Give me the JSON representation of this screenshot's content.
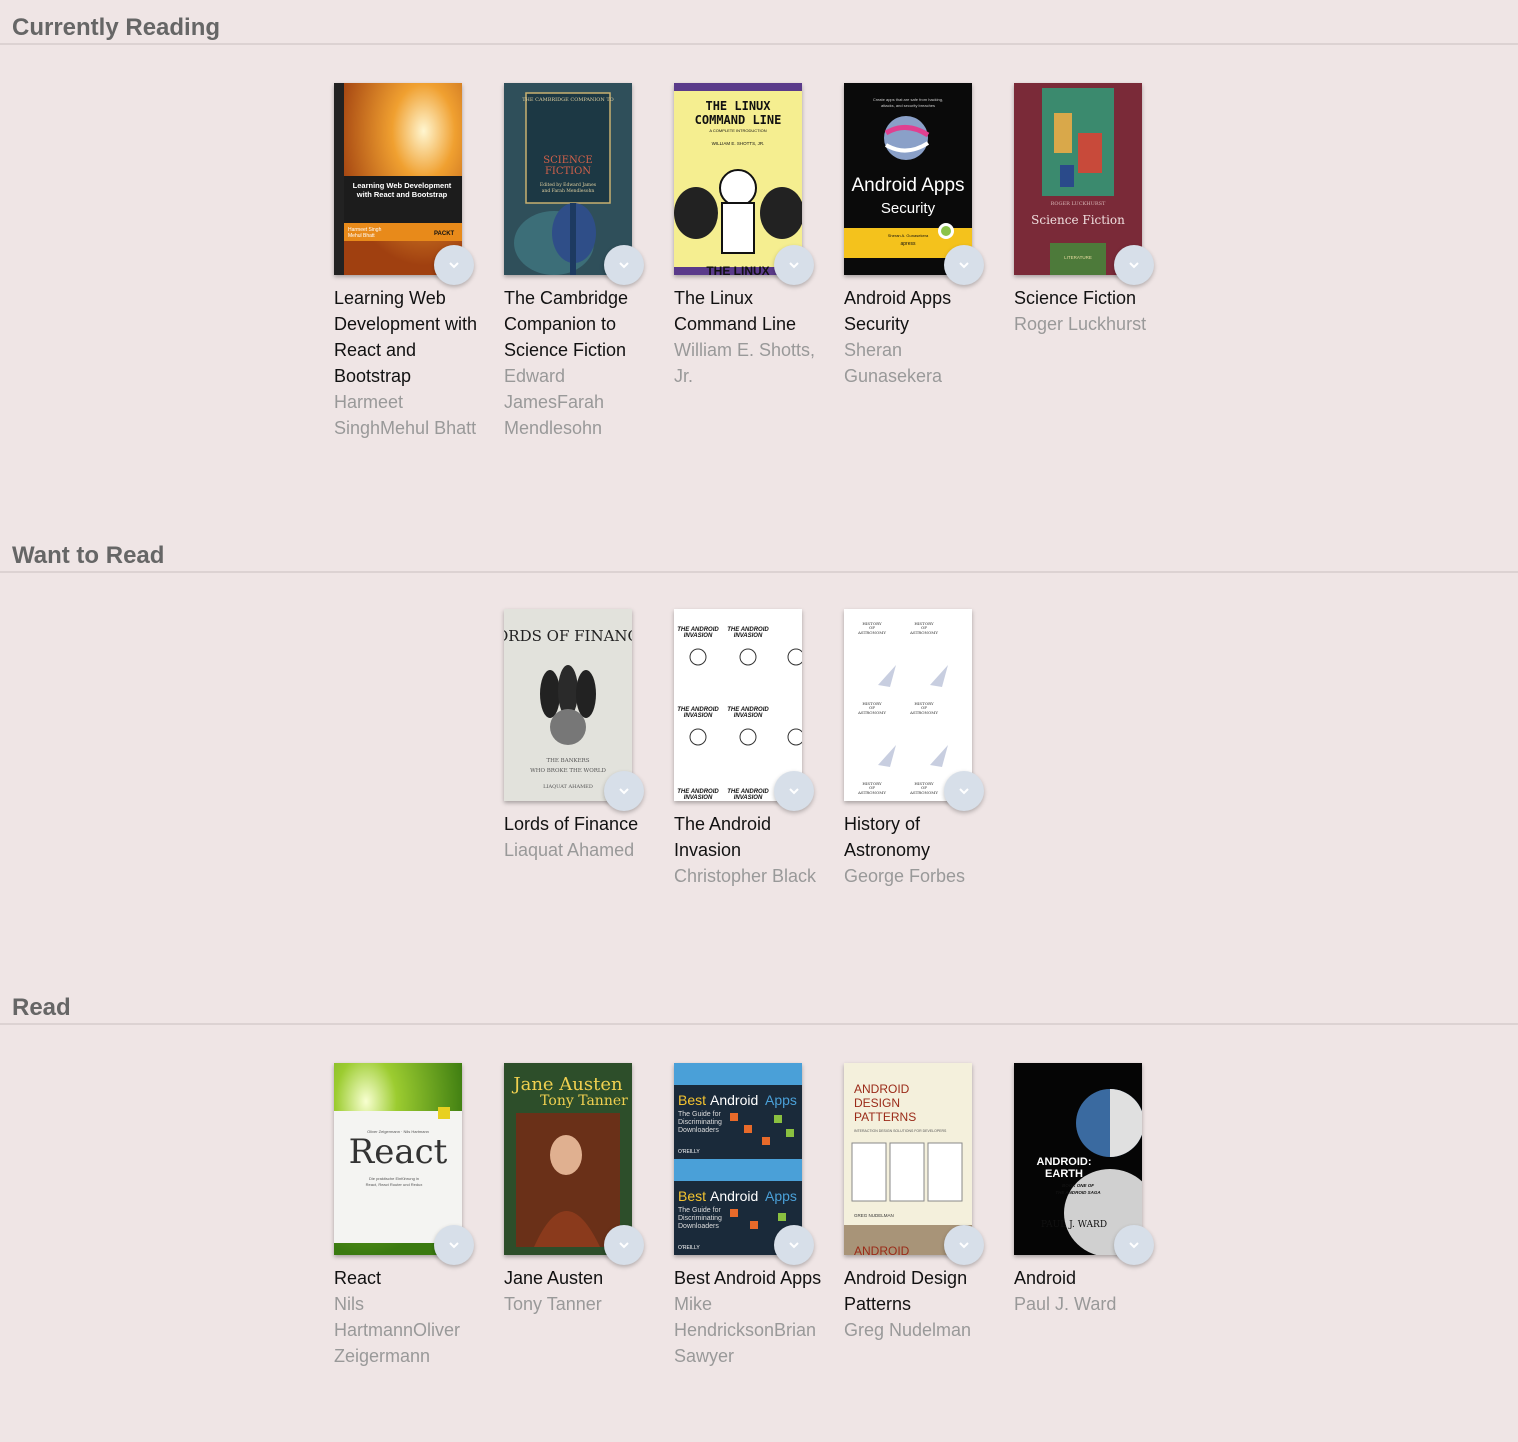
{
  "shelves": [
    {
      "title": "Currently Reading",
      "books": [
        {
          "title": "Learning Web Development with React and Bootstrap",
          "authors": "Harmeet SinghMehul Bhatt",
          "cover": "react-bootstrap"
        },
        {
          "title": "The Cambridge Companion to Science Fiction",
          "authors": "Edward JamesFarah Mendlesohn",
          "cover": "cambridge-sf"
        },
        {
          "title": "The Linux Command Line",
          "authors": "William E. Shotts, Jr.",
          "cover": "linux-cl"
        },
        {
          "title": "Android Apps Security",
          "authors": "Sheran Gunasekera",
          "cover": "android-security"
        },
        {
          "title": "Science Fiction",
          "authors": "Roger Luckhurst",
          "cover": "science-fiction"
        }
      ]
    },
    {
      "title": "Want to Read",
      "books": [
        {
          "title": "Lords of Finance",
          "authors": "Liaquat Ahamed",
          "cover": "lords-finance"
        },
        {
          "title": "The Android Invasion",
          "authors": "Christopher Black",
          "cover": "android-invasion"
        },
        {
          "title": "History of Astronomy",
          "authors": "George Forbes",
          "cover": "astronomy"
        }
      ]
    },
    {
      "title": "Read",
      "books": [
        {
          "title": "React",
          "authors": "Nils HartmannOliver Zeigermann",
          "cover": "react"
        },
        {
          "title": "Jane Austen",
          "authors": "Tony Tanner",
          "cover": "jane-austen"
        },
        {
          "title": "Best Android Apps",
          "authors": "Mike HendricksonBrian Sawyer",
          "cover": "best-android"
        },
        {
          "title": "Android Design Patterns",
          "authors": "Greg Nudelman",
          "cover": "design-patterns"
        },
        {
          "title": "Android",
          "authors": "Paul J. Ward",
          "cover": "android-earth"
        }
      ]
    }
  ],
  "covers": {
    "react-bootstrap": {
      "lines": [
        "Learning Web Development",
        "with React and Bootstrap",
        "Harmeet Singh",
        "Mehul Bhatt",
        "PACKT"
      ]
    },
    "cambridge-sf": {
      "lines": [
        "THE CAMBRIDGE COMPANION TO",
        "SCIENCE",
        "FICTION",
        "Edited by Edward James",
        "and Farah Mendlesohn"
      ]
    },
    "linux-cl": {
      "lines": [
        "THE LINUX",
        "COMMAND LINE",
        "A COMPLETE INTRODUCTION",
        "WILLIAM E. SHOTTS, JR.",
        "THE LINUX"
      ]
    },
    "android-security": {
      "lines": [
        "Create apps that are safe from hacking,",
        "attacks, and security breaches",
        "Android Apps",
        "Security",
        "Sheran A. Gunasekera",
        "apress"
      ]
    },
    "science-fiction": {
      "lines": [
        "ROGER LUCKHURST",
        "Science Fiction",
        "LITERATURE"
      ]
    },
    "lords-finance": {
      "lines": [
        "LORDS OF FINANCE",
        "THE BANKERS",
        "WHO BROKE THE WORLD",
        "LIAQUAT AHAMED"
      ]
    },
    "android-invasion": {
      "lines": [
        "THE ANDROID",
        "INVASION",
        "Christopher Black"
      ]
    },
    "astronomy": {
      "lines": [
        "HISTORY",
        "OF",
        "ASTRONOMY"
      ]
    },
    "react": {
      "lines": [
        "Oliver Zeigermann · Nils Hartmann",
        "React",
        "Die praktische Einführung in",
        "React, React Router und Redux"
      ]
    },
    "jane-austen": {
      "lines": [
        "Jane Austen",
        "Tony Tanner"
      ]
    },
    "best-android": {
      "lines": [
        "Best",
        "Android",
        "Apps",
        "The Guide for",
        "Discriminating",
        "Downloaders",
        "O'REILLY"
      ]
    },
    "design-patterns": {
      "lines": [
        "ANDROID",
        "DESIGN",
        "PATTERNS",
        "INTERACTION DESIGN SOLUTIONS FOR DEVELOPERS",
        "GREG NUDELMAN",
        "ANDROID"
      ]
    },
    "android-earth": {
      "lines": [
        "ANDROID:",
        "EARTH",
        "BOOK ONE OF",
        "THE ANDROID SAGA",
        "PAUL J. WARD"
      ]
    }
  },
  "colors": {
    "background": "#efe5e5",
    "shelf_title": "#666666",
    "book_title": "#111111",
    "book_authors": "#999999",
    "shelf_changer": "#d7dfe9"
  },
  "icons": {
    "shelf_changer": "chevron-down-icon"
  }
}
